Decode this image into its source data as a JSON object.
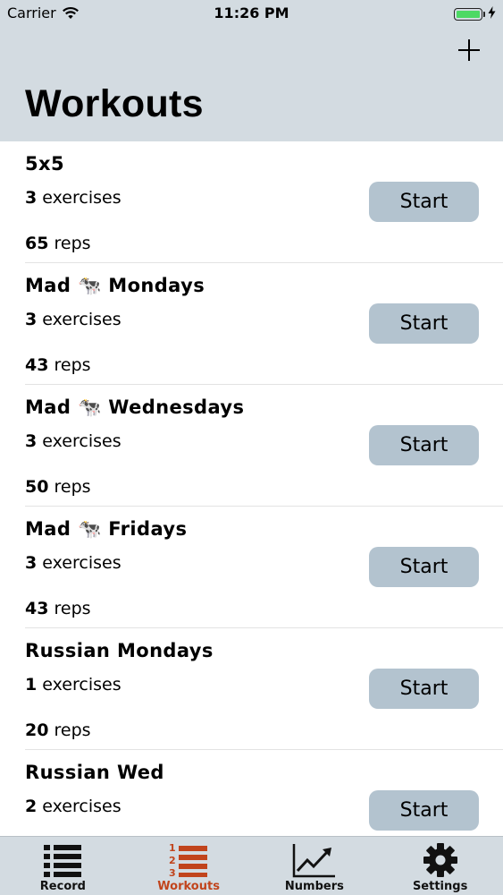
{
  "status_bar": {
    "carrier": "Carrier",
    "time": "11:26 PM"
  },
  "header": {
    "title": "Workouts",
    "add_icon": "plus-icon"
  },
  "workouts": [
    {
      "title": "5x5",
      "exercises_count": "3",
      "exercises_label": "exercises",
      "reps_count": "65",
      "reps_label": "reps",
      "start_label": "Start"
    },
    {
      "title": "Mad 🐄 Mondays",
      "exercises_count": "3",
      "exercises_label": "exercises",
      "reps_count": "43",
      "reps_label": "reps",
      "start_label": "Start"
    },
    {
      "title": "Mad 🐄 Wednesdays",
      "exercises_count": "3",
      "exercises_label": "exercises",
      "reps_count": "50",
      "reps_label": "reps",
      "start_label": "Start"
    },
    {
      "title": "Mad 🐄 Fridays",
      "exercises_count": "3",
      "exercises_label": "exercises",
      "reps_count": "43",
      "reps_label": "reps",
      "start_label": "Start"
    },
    {
      "title": "Russian Mondays",
      "exercises_count": "1",
      "exercises_label": "exercises",
      "reps_count": "20",
      "reps_label": "reps",
      "start_label": "Start"
    },
    {
      "title": "Russian Wed",
      "exercises_count": "2",
      "exercises_label": "exercises",
      "reps_count": "",
      "reps_label": "",
      "start_label": "Start"
    }
  ],
  "tab_bar": {
    "tabs": [
      {
        "label": "Record",
        "icon": "list-icon",
        "active": false
      },
      {
        "label": "Workouts",
        "icon": "numbered-list-icon",
        "active": true
      },
      {
        "label": "Numbers",
        "icon": "line-chart-icon",
        "active": false
      },
      {
        "label": "Settings",
        "icon": "gear-icon",
        "active": false
      }
    ]
  },
  "colors": {
    "header_bg": "#d3dbe1",
    "button_bg": "#b3c3cf",
    "active_tab": "#c1441c",
    "battery": "#4cd964"
  }
}
